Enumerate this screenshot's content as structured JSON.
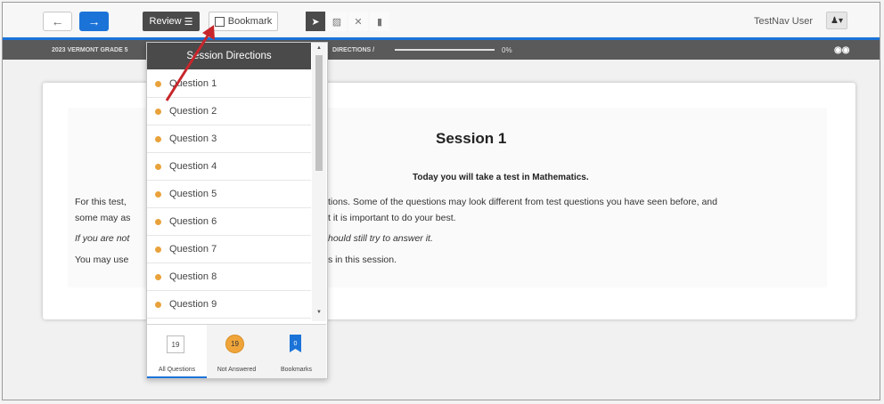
{
  "toolbar": {
    "back_icon": "←",
    "next_icon": "→",
    "review_label": "Review",
    "review_icon": "☰",
    "bookmark_label": "Bookmark",
    "tools": [
      "pointer-icon",
      "highlighter-icon",
      "eliminator-icon",
      "calculator-icon"
    ],
    "tool_glyphs": [
      "➤",
      "▨",
      "✕",
      "▮"
    ],
    "user_name": "TestNav User",
    "user_icon": "♟▾"
  },
  "status": {
    "test_title": "2023 VERMONT GRADE 5",
    "section": "DIRECTIONS  /",
    "progress_percent": "0%",
    "glasses_icon": "👓"
  },
  "session": {
    "title": "Session 1",
    "subtitle": "Today you will take a test in Mathematics.",
    "line1a": "For this test, ",
    "line1b": "tions. Some of the questions may look different from test questions you have seen before, and",
    "line2a": "some may as",
    "line2b": "t it is important to do your best.",
    "line3a": "If you are not",
    "line3b": "hould still try to answer it.",
    "line4a": "You may use",
    "line4b": "s in this session."
  },
  "review_panel": {
    "header": "Session Directions",
    "questions": [
      "Question 1",
      "Question 2",
      "Question 3",
      "Question 4",
      "Question 5",
      "Question 6",
      "Question 7",
      "Question 8",
      "Question 9"
    ],
    "tabs": [
      {
        "label": "All Questions",
        "count": "19"
      },
      {
        "label": "Not Answered",
        "count": "19"
      },
      {
        "label": "Bookmarks",
        "count": "0"
      }
    ]
  },
  "colors": {
    "accent": "#1b73d8",
    "unanswered": "#e9a23b",
    "annotation_arrow": "#c8262b"
  }
}
